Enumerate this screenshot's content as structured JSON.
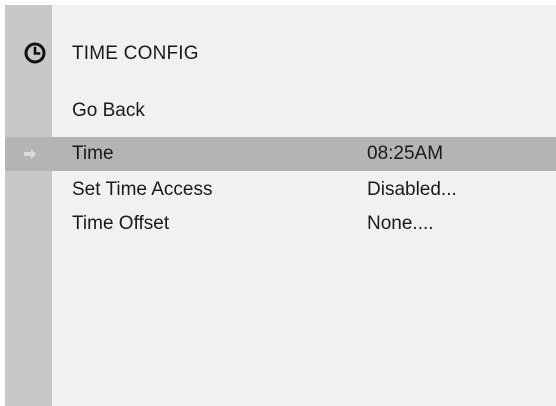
{
  "header": {
    "icon": "clock-icon",
    "title": "TIME CONFIG"
  },
  "menu": {
    "go_back": "Go Back",
    "items": [
      {
        "label": "Time",
        "value": "08:25AM",
        "selected": true
      },
      {
        "label": "Set Time Access",
        "value": "Disabled...",
        "selected": false
      },
      {
        "label": "Time Offset",
        "value": "None....",
        "selected": false
      }
    ]
  },
  "selection_indicator": "arrow-right-icon",
  "colors": {
    "background": "#f1f1f1",
    "sidebar": "#c6c8ca",
    "selected_row": "#b2b4b6",
    "text": "#1a1a1a"
  }
}
